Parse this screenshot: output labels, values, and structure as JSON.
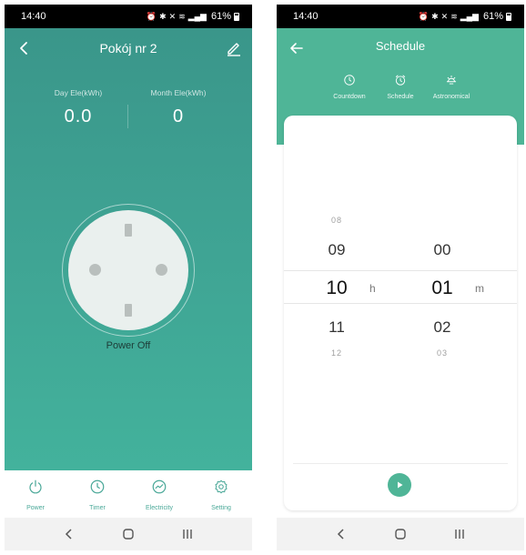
{
  "left_phone": {
    "status_bar": {
      "time": "14:40",
      "battery": "61%"
    },
    "header": {
      "title": "Pokój nr 2"
    },
    "stats": [
      {
        "label": "Day Ele(kWh)",
        "value": "0.0"
      },
      {
        "label": "Month Ele(kWh)",
        "value": "0"
      }
    ],
    "power_status": "Power Off",
    "bottom_nav": [
      {
        "label": "Power",
        "icon": "power-icon"
      },
      {
        "label": "Timer",
        "icon": "clock-icon"
      },
      {
        "label": "Electricity",
        "icon": "chart-icon"
      },
      {
        "label": "Setting",
        "icon": "gear-icon"
      }
    ]
  },
  "right_phone": {
    "status_bar": {
      "time": "14:40",
      "battery": "61%"
    },
    "header": {
      "title": "Schedule"
    },
    "tabs": [
      {
        "label": "Countdown",
        "icon": "timer-icon"
      },
      {
        "label": "Schedule",
        "icon": "alarm-icon"
      },
      {
        "label": "Astronomical",
        "icon": "sun-icon"
      }
    ],
    "picker": {
      "hours": [
        "08",
        "09",
        "10",
        "11",
        "12"
      ],
      "hours_unit": "h",
      "minutes": [
        "",
        "00",
        "01",
        "02",
        "03"
      ],
      "minutes_unit": "m",
      "selected_hour": "10",
      "selected_minute": "01"
    }
  },
  "colors": {
    "teal_dark": "#3a968a",
    "teal_light": "#43b29c",
    "teal_header": "#4fb597",
    "icon_teal": "#4aa898"
  }
}
